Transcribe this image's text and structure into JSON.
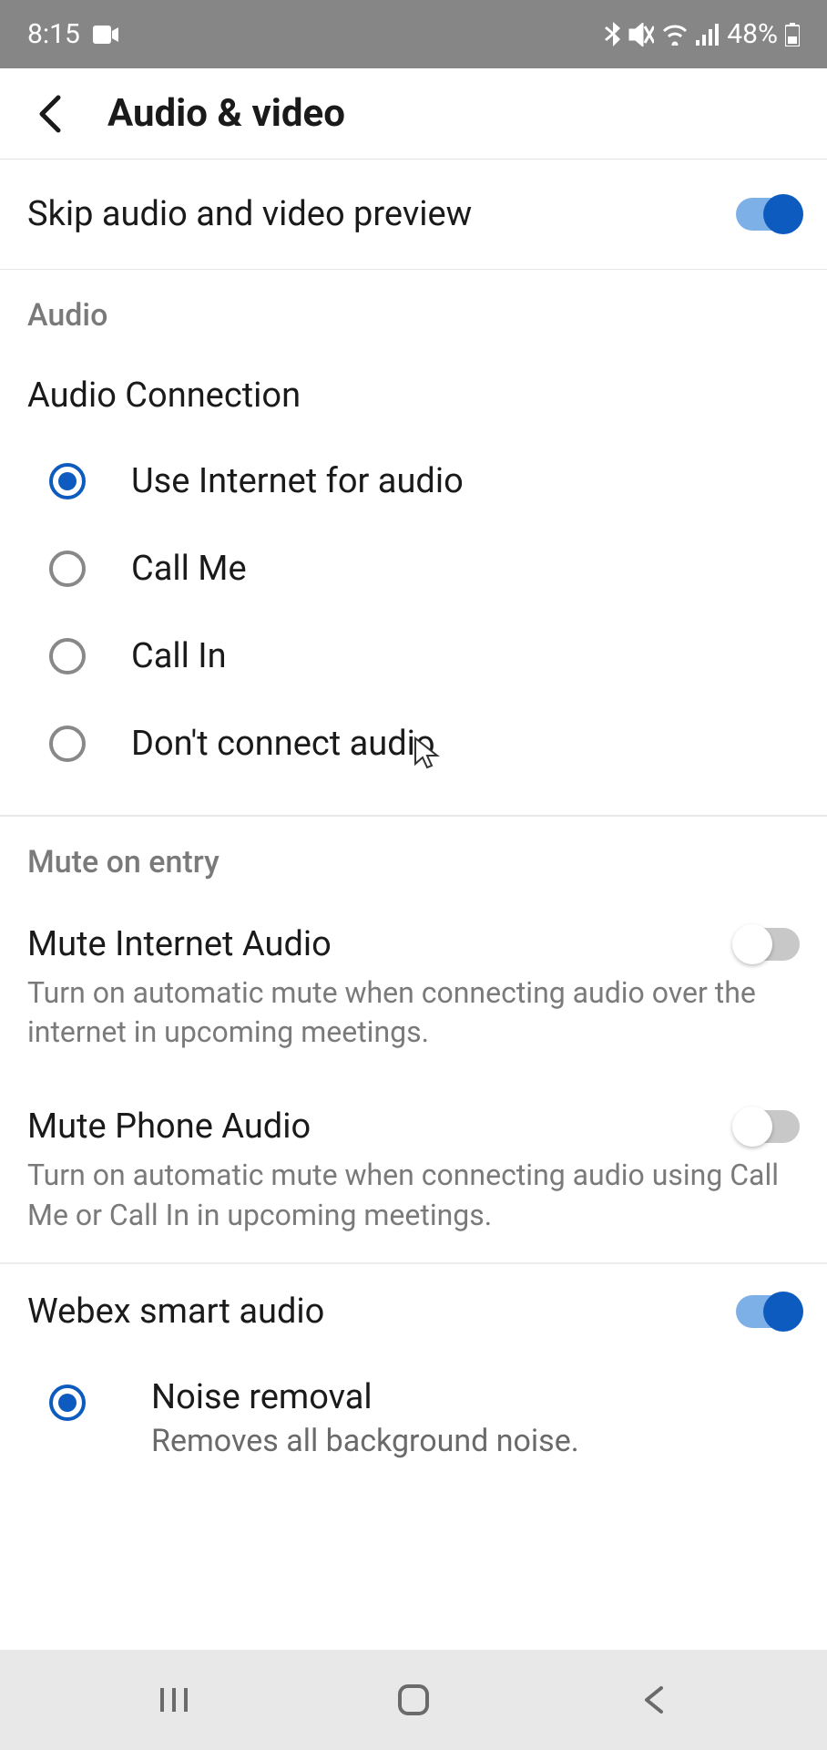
{
  "status": {
    "time": "8:15",
    "battery": "48%"
  },
  "header": {
    "title": "Audio & video"
  },
  "skip_preview": {
    "label": "Skip audio and video preview",
    "on": true
  },
  "audio": {
    "header": "Audio",
    "connection_title": "Audio Connection",
    "options": [
      {
        "label": "Use Internet for audio",
        "selected": true
      },
      {
        "label": "Call Me",
        "selected": false
      },
      {
        "label": "Call In",
        "selected": false
      },
      {
        "label": "Don't connect audio",
        "selected": false
      }
    ]
  },
  "mute_on_entry": {
    "header": "Mute on entry",
    "internet": {
      "title": "Mute Internet Audio",
      "desc": "Turn on automatic mute when connecting audio over the internet in upcoming meetings.",
      "on": false
    },
    "phone": {
      "title": "Mute Phone Audio",
      "desc": "Turn on automatic mute when connecting audio using Call Me or Call In in upcoming meetings.",
      "on": false
    }
  },
  "smart_audio": {
    "label": "Webex smart audio",
    "on": true,
    "noise": {
      "title": "Noise removal",
      "desc": "Removes all background noise.",
      "selected": true
    }
  }
}
